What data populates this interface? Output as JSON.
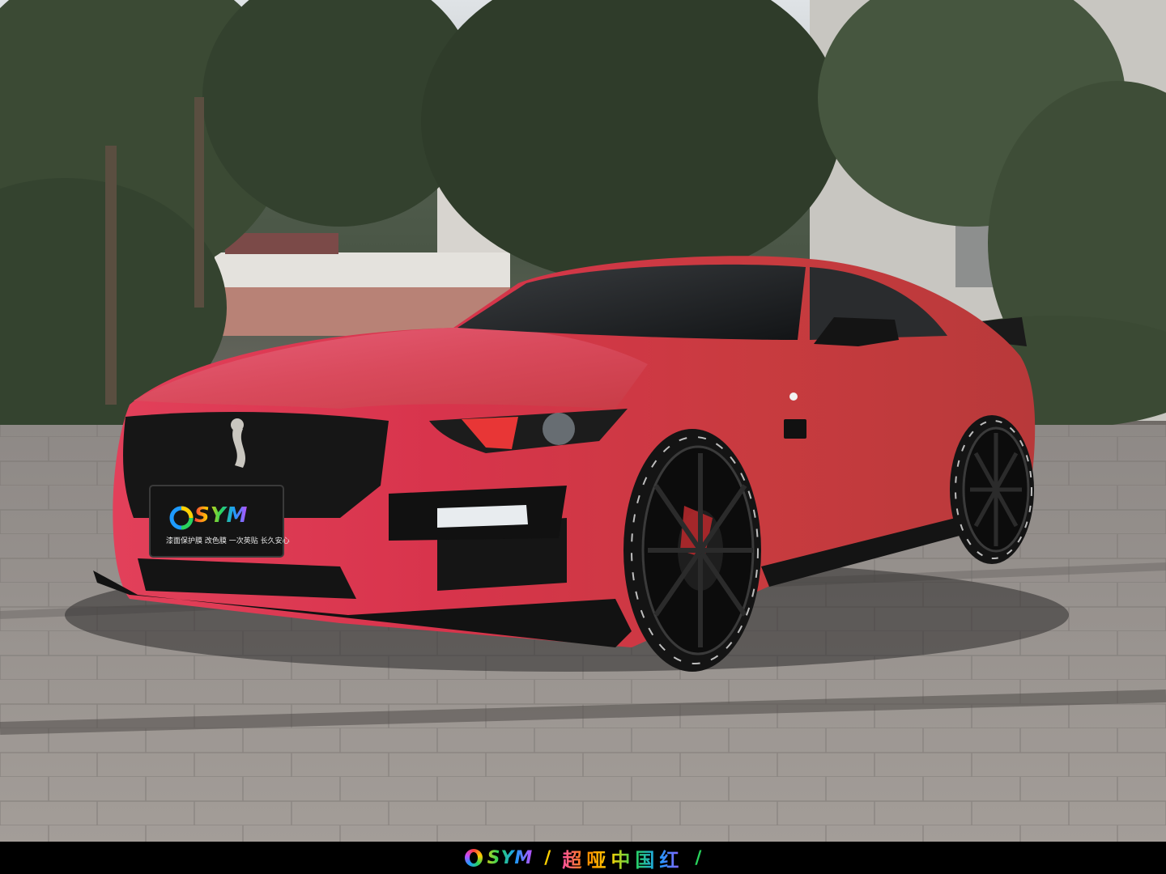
{
  "plate": {
    "brand": "SYM",
    "slogan": "漆面保护膜  改色膜  一次英贴  长久安心"
  },
  "caption": {
    "brand": "SYM",
    "separator_left": "/",
    "text": "超哑中国红",
    "separator_right": "/"
  },
  "colors": {
    "car_body": "#d23a44",
    "car_highlight": "#ea3e6a",
    "grille": "#161616",
    "pavement": "#9a9490",
    "foliage": "#3b4a34"
  },
  "icons": {
    "hood_emblem": "cobra-emblem-icon",
    "plate_logo": "sym-ring-logo-icon"
  }
}
